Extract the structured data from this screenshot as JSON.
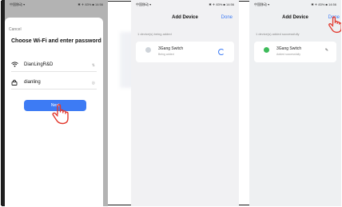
{
  "screen1": {
    "status_left": "中国移动 ▾",
    "status_right": "✱ ✈ 83% ■ 14:56",
    "cancel_label": "Cancel",
    "title": "Choose Wi-Fi and enter password",
    "wifi_name": "DianLingR&D",
    "wifi_suffix": "⇅",
    "password": "dianling",
    "eye_icon": "◎",
    "next_label": "Next"
  },
  "screen2": {
    "status_left": "中国移动 ▾",
    "status_right": "✱ ✈ 83% ■ 14:56",
    "title": "Add Device",
    "done_label": "Done",
    "hint": "1 device(s) being added",
    "device_name": "3Gang Switch",
    "device_status": "Being added"
  },
  "screen3": {
    "status_left": "中国移动 ▾",
    "status_right": "✱ ✈ 83% ■ 14:56",
    "title": "Add Device",
    "done_label": "Done",
    "hint": "1 device(s) added successfully",
    "device_name": "3Gang Switch",
    "device_status": "Added successfully",
    "edit_icon": "✎"
  },
  "colors": {
    "accent": "#3d7bf4",
    "tap_hand": "#e2382d",
    "device_green": "#3dbb5a"
  },
  "icons": [
    "wifi-icon",
    "lock-icon",
    "eye-icon",
    "tap-hand-icon",
    "device-icon",
    "spinner-icon",
    "edit-icon"
  ]
}
